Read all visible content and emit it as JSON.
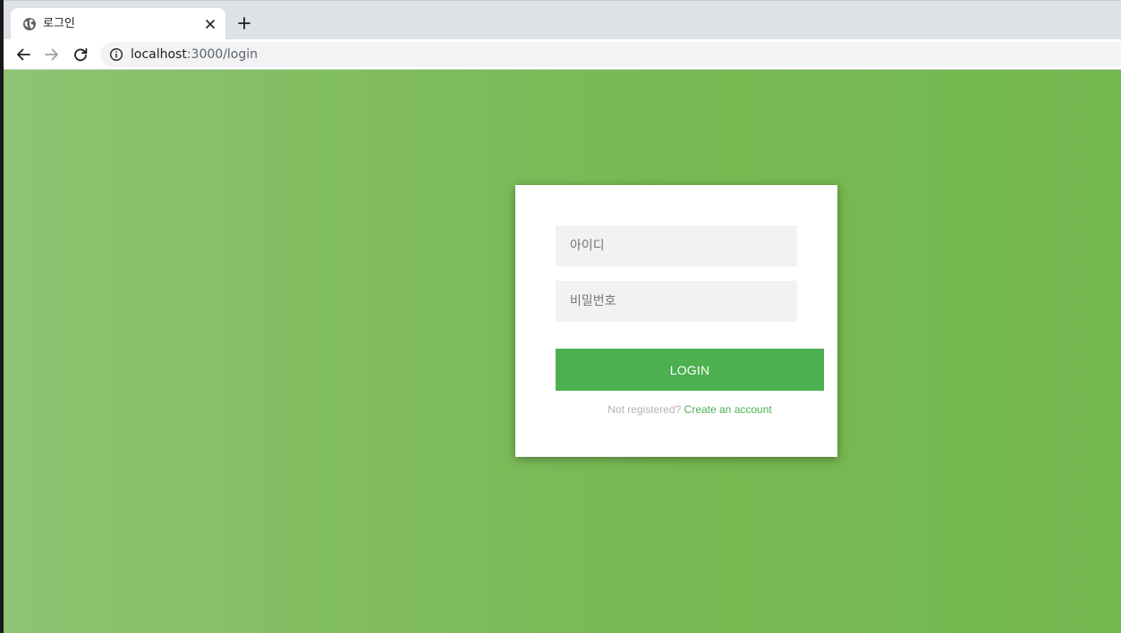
{
  "browser": {
    "tab": {
      "title": "로그인",
      "favicon": "globe-icon",
      "close_icon": "close-icon"
    },
    "new_tab_icon": "plus-icon",
    "nav": {
      "back_icon": "back-arrow-icon",
      "forward_icon": "forward-arrow-icon",
      "reload_icon": "reload-icon"
    },
    "address": {
      "info_icon": "info-icon",
      "host": "localhost",
      "path": ":3000/login"
    }
  },
  "login_form": {
    "username_placeholder": "아이디",
    "password_placeholder": "비밀번호",
    "login_button_label": "LOGIN",
    "register_prompt": "Not registered?",
    "register_link_text": "Create an account"
  },
  "colors": {
    "accent_green": "#4caf50",
    "background_green_light": "#8ec472",
    "background_green_dark": "#75b74f",
    "input_background": "#f2f2f2"
  }
}
